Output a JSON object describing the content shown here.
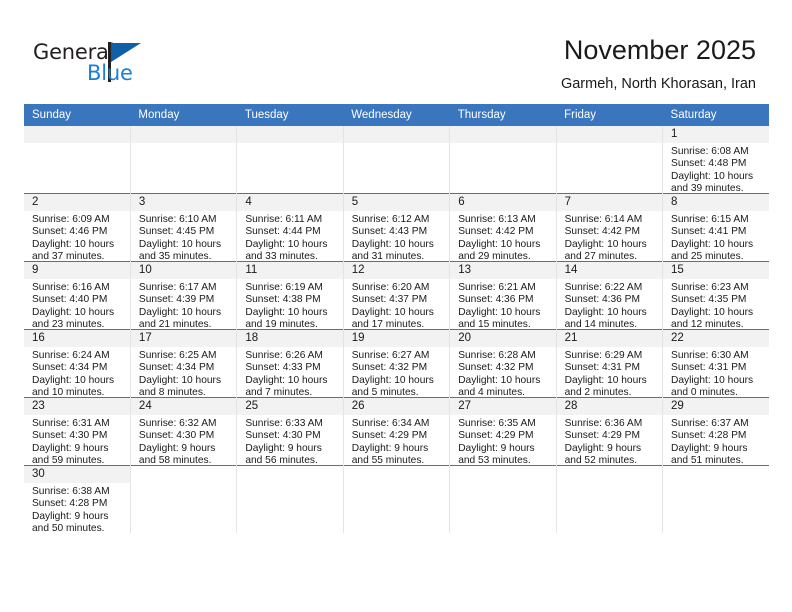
{
  "brand": {
    "name_top": "General",
    "name_bottom": "Blue",
    "flag_icon": "blue-flag-icon",
    "color_dark": "#231f20",
    "color_blue": "#1b7fd4",
    "color_flag": "#105fa8"
  },
  "header": {
    "title": "November 2025",
    "subtitle": "Garmeh, North Khorasan, Iran",
    "accent_color": "#3a76bd",
    "band_color": "#f2f2f2"
  },
  "weekday_headers": [
    "Sunday",
    "Monday",
    "Tuesday",
    "Wednesday",
    "Thursday",
    "Friday",
    "Saturday"
  ],
  "weeks": [
    [
      {
        "day": "",
        "sunrise": "",
        "sunset": "",
        "daylight_1": "",
        "daylight_2": "",
        "empty": true
      },
      {
        "day": "",
        "sunrise": "",
        "sunset": "",
        "daylight_1": "",
        "daylight_2": "",
        "empty": true
      },
      {
        "day": "",
        "sunrise": "",
        "sunset": "",
        "daylight_1": "",
        "daylight_2": "",
        "empty": true
      },
      {
        "day": "",
        "sunrise": "",
        "sunset": "",
        "daylight_1": "",
        "daylight_2": "",
        "empty": true
      },
      {
        "day": "",
        "sunrise": "",
        "sunset": "",
        "daylight_1": "",
        "daylight_2": "",
        "empty": true
      },
      {
        "day": "",
        "sunrise": "",
        "sunset": "",
        "daylight_1": "",
        "daylight_2": "",
        "empty": true
      },
      {
        "day": "1",
        "sunrise": "Sunrise: 6:08 AM",
        "sunset": "Sunset: 4:48 PM",
        "daylight_1": "Daylight: 10 hours",
        "daylight_2": "and 39 minutes."
      }
    ],
    [
      {
        "day": "2",
        "sunrise": "Sunrise: 6:09 AM",
        "sunset": "Sunset: 4:46 PM",
        "daylight_1": "Daylight: 10 hours",
        "daylight_2": "and 37 minutes."
      },
      {
        "day": "3",
        "sunrise": "Sunrise: 6:10 AM",
        "sunset": "Sunset: 4:45 PM",
        "daylight_1": "Daylight: 10 hours",
        "daylight_2": "and 35 minutes."
      },
      {
        "day": "4",
        "sunrise": "Sunrise: 6:11 AM",
        "sunset": "Sunset: 4:44 PM",
        "daylight_1": "Daylight: 10 hours",
        "daylight_2": "and 33 minutes."
      },
      {
        "day": "5",
        "sunrise": "Sunrise: 6:12 AM",
        "sunset": "Sunset: 4:43 PM",
        "daylight_1": "Daylight: 10 hours",
        "daylight_2": "and 31 minutes."
      },
      {
        "day": "6",
        "sunrise": "Sunrise: 6:13 AM",
        "sunset": "Sunset: 4:42 PM",
        "daylight_1": "Daylight: 10 hours",
        "daylight_2": "and 29 minutes."
      },
      {
        "day": "7",
        "sunrise": "Sunrise: 6:14 AM",
        "sunset": "Sunset: 4:42 PM",
        "daylight_1": "Daylight: 10 hours",
        "daylight_2": "and 27 minutes."
      },
      {
        "day": "8",
        "sunrise": "Sunrise: 6:15 AM",
        "sunset": "Sunset: 4:41 PM",
        "daylight_1": "Daylight: 10 hours",
        "daylight_2": "and 25 minutes."
      }
    ],
    [
      {
        "day": "9",
        "sunrise": "Sunrise: 6:16 AM",
        "sunset": "Sunset: 4:40 PM",
        "daylight_1": "Daylight: 10 hours",
        "daylight_2": "and 23 minutes."
      },
      {
        "day": "10",
        "sunrise": "Sunrise: 6:17 AM",
        "sunset": "Sunset: 4:39 PM",
        "daylight_1": "Daylight: 10 hours",
        "daylight_2": "and 21 minutes."
      },
      {
        "day": "11",
        "sunrise": "Sunrise: 6:19 AM",
        "sunset": "Sunset: 4:38 PM",
        "daylight_1": "Daylight: 10 hours",
        "daylight_2": "and 19 minutes."
      },
      {
        "day": "12",
        "sunrise": "Sunrise: 6:20 AM",
        "sunset": "Sunset: 4:37 PM",
        "daylight_1": "Daylight: 10 hours",
        "daylight_2": "and 17 minutes."
      },
      {
        "day": "13",
        "sunrise": "Sunrise: 6:21 AM",
        "sunset": "Sunset: 4:36 PM",
        "daylight_1": "Daylight: 10 hours",
        "daylight_2": "and 15 minutes."
      },
      {
        "day": "14",
        "sunrise": "Sunrise: 6:22 AM",
        "sunset": "Sunset: 4:36 PM",
        "daylight_1": "Daylight: 10 hours",
        "daylight_2": "and 14 minutes."
      },
      {
        "day": "15",
        "sunrise": "Sunrise: 6:23 AM",
        "sunset": "Sunset: 4:35 PM",
        "daylight_1": "Daylight: 10 hours",
        "daylight_2": "and 12 minutes."
      }
    ],
    [
      {
        "day": "16",
        "sunrise": "Sunrise: 6:24 AM",
        "sunset": "Sunset: 4:34 PM",
        "daylight_1": "Daylight: 10 hours",
        "daylight_2": "and 10 minutes."
      },
      {
        "day": "17",
        "sunrise": "Sunrise: 6:25 AM",
        "sunset": "Sunset: 4:34 PM",
        "daylight_1": "Daylight: 10 hours",
        "daylight_2": "and 8 minutes."
      },
      {
        "day": "18",
        "sunrise": "Sunrise: 6:26 AM",
        "sunset": "Sunset: 4:33 PM",
        "daylight_1": "Daylight: 10 hours",
        "daylight_2": "and 7 minutes."
      },
      {
        "day": "19",
        "sunrise": "Sunrise: 6:27 AM",
        "sunset": "Sunset: 4:32 PM",
        "daylight_1": "Daylight: 10 hours",
        "daylight_2": "and 5 minutes."
      },
      {
        "day": "20",
        "sunrise": "Sunrise: 6:28 AM",
        "sunset": "Sunset: 4:32 PM",
        "daylight_1": "Daylight: 10 hours",
        "daylight_2": "and 4 minutes."
      },
      {
        "day": "21",
        "sunrise": "Sunrise: 6:29 AM",
        "sunset": "Sunset: 4:31 PM",
        "daylight_1": "Daylight: 10 hours",
        "daylight_2": "and 2 minutes."
      },
      {
        "day": "22",
        "sunrise": "Sunrise: 6:30 AM",
        "sunset": "Sunset: 4:31 PM",
        "daylight_1": "Daylight: 10 hours",
        "daylight_2": "and 0 minutes."
      }
    ],
    [
      {
        "day": "23",
        "sunrise": "Sunrise: 6:31 AM",
        "sunset": "Sunset: 4:30 PM",
        "daylight_1": "Daylight: 9 hours",
        "daylight_2": "and 59 minutes."
      },
      {
        "day": "24",
        "sunrise": "Sunrise: 6:32 AM",
        "sunset": "Sunset: 4:30 PM",
        "daylight_1": "Daylight: 9 hours",
        "daylight_2": "and 58 minutes."
      },
      {
        "day": "25",
        "sunrise": "Sunrise: 6:33 AM",
        "sunset": "Sunset: 4:30 PM",
        "daylight_1": "Daylight: 9 hours",
        "daylight_2": "and 56 minutes."
      },
      {
        "day": "26",
        "sunrise": "Sunrise: 6:34 AM",
        "sunset": "Sunset: 4:29 PM",
        "daylight_1": "Daylight: 9 hours",
        "daylight_2": "and 55 minutes."
      },
      {
        "day": "27",
        "sunrise": "Sunrise: 6:35 AM",
        "sunset": "Sunset: 4:29 PM",
        "daylight_1": "Daylight: 9 hours",
        "daylight_2": "and 53 minutes."
      },
      {
        "day": "28",
        "sunrise": "Sunrise: 6:36 AM",
        "sunset": "Sunset: 4:29 PM",
        "daylight_1": "Daylight: 9 hours",
        "daylight_2": "and 52 minutes."
      },
      {
        "day": "29",
        "sunrise": "Sunrise: 6:37 AM",
        "sunset": "Sunset: 4:28 PM",
        "daylight_1": "Daylight: 9 hours",
        "daylight_2": "and 51 minutes."
      }
    ],
    [
      {
        "day": "30",
        "sunrise": "Sunrise: 6:38 AM",
        "sunset": "Sunset: 4:28 PM",
        "daylight_1": "Daylight: 9 hours",
        "daylight_2": "and 50 minutes."
      },
      {
        "day": "",
        "sunrise": "",
        "sunset": "",
        "daylight_1": "",
        "daylight_2": "",
        "blank": true
      },
      {
        "day": "",
        "sunrise": "",
        "sunset": "",
        "daylight_1": "",
        "daylight_2": "",
        "blank": true
      },
      {
        "day": "",
        "sunrise": "",
        "sunset": "",
        "daylight_1": "",
        "daylight_2": "",
        "blank": true
      },
      {
        "day": "",
        "sunrise": "",
        "sunset": "",
        "daylight_1": "",
        "daylight_2": "",
        "blank": true
      },
      {
        "day": "",
        "sunrise": "",
        "sunset": "",
        "daylight_1": "",
        "daylight_2": "",
        "blank": true
      },
      {
        "day": "",
        "sunrise": "",
        "sunset": "",
        "daylight_1": "",
        "daylight_2": "",
        "blank": true
      }
    ]
  ]
}
